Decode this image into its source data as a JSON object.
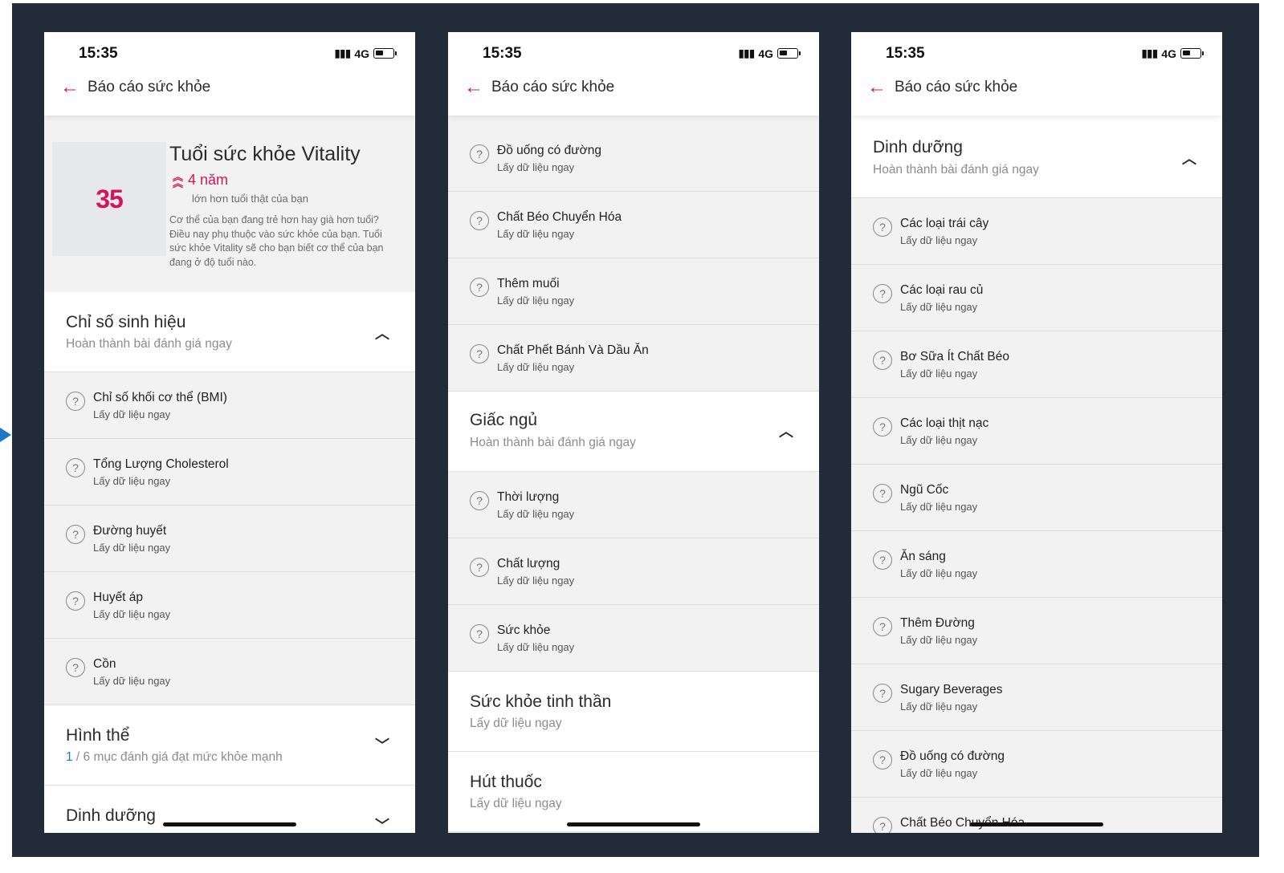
{
  "status": {
    "time": "15:35",
    "network": "4G"
  },
  "header": {
    "title": "Báo cáo sức khỏe"
  },
  "hero": {
    "age": "35",
    "title": "Tuổi sức khỏe Vitality",
    "delta": "4 năm",
    "delta_sub": "lớn hơn tuổi thật của bạn",
    "description": "Cơ thể của bạn đang trẻ hơn hay già hơn tuổi? Điều nay phụ thuộc vào sức khỏe của bạn. Tuổi sức khỏe Vitality sẽ cho bạn biết cơ thể của bạn đang ở độ tuổi nào."
  },
  "common": {
    "fetch_now": "Lấy dữ liệu ngay",
    "complete_now": "Hoàn thành bài đánh giá ngay"
  },
  "screen1": {
    "vitals": {
      "title": "Chỉ số sinh hiệu",
      "items": [
        "Chỉ số khối cơ thể (BMI)",
        "Tổng Lượng Cholesterol",
        "Đường huyết",
        "Huyết áp",
        "Cồn"
      ]
    },
    "physique": {
      "title": "Hình thể",
      "count": "1",
      "rest": " / 6 mục đánh giá đạt mức khỏe mạnh"
    },
    "nutrition": {
      "title": "Dinh dưỡng"
    }
  },
  "screen2": {
    "nutrition_tail": [
      "Đồ uống có đường",
      "Chất Béo Chuyển Hóa",
      "Thêm muối",
      "Chất Phết Bánh Và Dầu Ăn"
    ],
    "sleep": {
      "title": "Giấc ngủ",
      "items": [
        "Thời lượng",
        "Chất lượng",
        "Sức khỏe"
      ]
    },
    "mental": {
      "title": "Sức khỏe tinh thần"
    },
    "smoking": {
      "title": "Hút thuốc"
    }
  },
  "screen3": {
    "nutrition": {
      "title": "Dinh dưỡng",
      "items": [
        "Các loại trái cây",
        "Các loại rau củ",
        "Bơ Sữa Ít Chất Béo",
        "Các loại thịt nạc",
        "Ngũ Cốc",
        "Ăn sáng",
        "Thêm Đường",
        "Sugary Beverages",
        "Đồ uống có đường",
        "Chất Béo Chuyển Hóa"
      ]
    }
  }
}
